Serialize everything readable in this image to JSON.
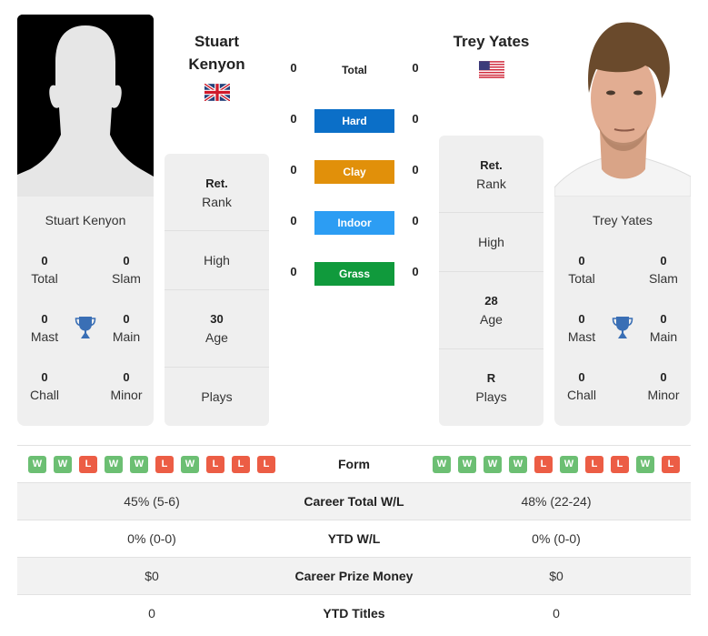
{
  "colors": {
    "hard": "#0b6fc8",
    "clay": "#e1900a",
    "indoor": "#2c9df3",
    "grass": "#109a3c",
    "win": "#6cbf73",
    "loss": "#ec5d45",
    "trophy": "#3a6fb5"
  },
  "left_player": {
    "name_line1": "Stuart",
    "name_line2": "Kenyon",
    "card_name": "Stuart Kenyon",
    "flag": "uk-flag",
    "photo": "silhouette-placeholder",
    "titles": {
      "total": {
        "value": "0",
        "label": "Total"
      },
      "slam": {
        "value": "0",
        "label": "Slam"
      },
      "mast": {
        "value": "0",
        "label": "Mast"
      },
      "main": {
        "value": "0",
        "label": "Main"
      },
      "chall": {
        "value": "0",
        "label": "Chall"
      },
      "minor": {
        "value": "0",
        "label": "Minor"
      }
    },
    "info": {
      "rank": {
        "value": "Ret.",
        "label": "Rank"
      },
      "high": {
        "value": "",
        "label": "High"
      },
      "age": {
        "value": "30",
        "label": "Age"
      },
      "plays": {
        "value": "",
        "label": "Plays"
      }
    },
    "form": [
      "W",
      "W",
      "L",
      "W",
      "W",
      "L",
      "W",
      "L",
      "L",
      "L"
    ]
  },
  "right_player": {
    "name": "Trey Yates",
    "card_name": "Trey Yates",
    "flag": "us-flag",
    "photo": "player-headshot",
    "titles": {
      "total": {
        "value": "0",
        "label": "Total"
      },
      "slam": {
        "value": "0",
        "label": "Slam"
      },
      "mast": {
        "value": "0",
        "label": "Mast"
      },
      "main": {
        "value": "0",
        "label": "Main"
      },
      "chall": {
        "value": "0",
        "label": "Chall"
      },
      "minor": {
        "value": "0",
        "label": "Minor"
      }
    },
    "info": {
      "rank": {
        "value": "Ret.",
        "label": "Rank"
      },
      "high": {
        "value": "",
        "label": "High"
      },
      "age": {
        "value": "28",
        "label": "Age"
      },
      "plays": {
        "value": "R",
        "label": "Plays"
      }
    },
    "form": [
      "W",
      "W",
      "W",
      "W",
      "L",
      "W",
      "L",
      "L",
      "W",
      "L"
    ]
  },
  "h2h": {
    "total": {
      "label": "Total",
      "left": "0",
      "right": "0"
    },
    "surfaces": [
      {
        "label": "Hard",
        "left": "0",
        "right": "0",
        "color": "#0b6fc8"
      },
      {
        "label": "Clay",
        "left": "0",
        "right": "0",
        "color": "#e1900a"
      },
      {
        "label": "Indoor",
        "left": "0",
        "right": "0",
        "color": "#2c9df3"
      },
      {
        "label": "Grass",
        "left": "0",
        "right": "0",
        "color": "#109a3c"
      }
    ]
  },
  "table": {
    "form_label": "Form",
    "rows": [
      {
        "label": "Career Total W/L",
        "left": "45% (5-6)",
        "right": "48% (22-24)"
      },
      {
        "label": "YTD W/L",
        "left": "0% (0-0)",
        "right": "0% (0-0)"
      },
      {
        "label": "Career Prize Money",
        "left": "$0",
        "right": "$0"
      },
      {
        "label": "YTD Titles",
        "left": "0",
        "right": "0"
      }
    ]
  }
}
